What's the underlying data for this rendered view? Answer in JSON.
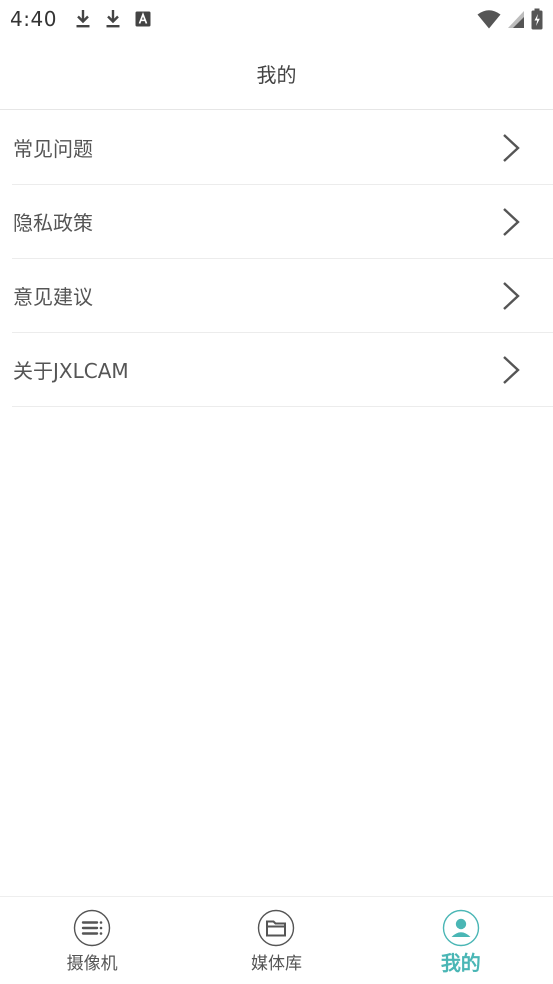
{
  "status_bar": {
    "time": "4:40",
    "left_icons": [
      "download-icon",
      "download-icon",
      "text-a-icon"
    ],
    "right_icons": [
      "wifi-icon",
      "signal-icon",
      "battery-icon"
    ]
  },
  "header": {
    "title": "我的"
  },
  "menu": {
    "items": [
      {
        "label": "常见问题",
        "icon": "chevron-right-icon"
      },
      {
        "label": "隐私政策",
        "icon": "chevron-right-icon"
      },
      {
        "label": "意见建议",
        "icon": "chevron-right-icon"
      },
      {
        "label": "关于JXLCAM",
        "icon": "chevron-right-icon"
      }
    ]
  },
  "bottom_nav": {
    "items": [
      {
        "label": "摄像机",
        "icon": "camera-list-icon",
        "active": false
      },
      {
        "label": "媒体库",
        "icon": "folder-icon",
        "active": false
      },
      {
        "label": "我的",
        "icon": "user-icon",
        "active": true
      }
    ]
  },
  "colors": {
    "accent": "#4ab6b5",
    "text": "#555555",
    "divider": "#ececec"
  }
}
